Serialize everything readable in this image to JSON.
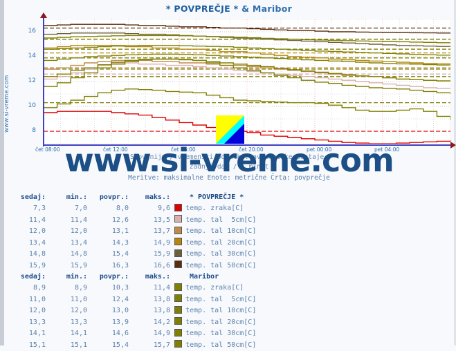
{
  "page": {
    "title": "* POVPREČJE * & Maribor",
    "title_main": "* POVPREČJE *",
    "title_amp": "& Maribor",
    "vertical_watermark": "www.si-vreme.com",
    "big_watermark": "www.si-vreme.com",
    "subtitle_line1": "Slovenija / vremenski podatki: avtomatske postaje.",
    "subtitle_line2": "zadnji dan / 5 minut",
    "subtitle_line3": "Meritve: maksimalne  Enote: metrične  Črta: povprečje"
  },
  "chart_data": {
    "type": "line",
    "title": "* POVPREČJE * & Maribor",
    "xlabel": "",
    "ylabel": "",
    "ylim": [
      7,
      17
    ],
    "yticks": [
      8,
      10,
      12,
      14,
      16
    ],
    "xticks": [
      "čet 08:00",
      "čet 12:00",
      "čet 16:00",
      "čet 20:00",
      "pet 00:00",
      "pet 04:00"
    ],
    "grid": true,
    "legend_position": "below-table",
    "series": [
      {
        "name": "* POVPREČJE * temp. zraka[C]",
        "color": "#e00000",
        "sedaj": 7.3,
        "min": 7.0,
        "povpr": 8.0,
        "maks": 9.6,
        "values": [
          9.5,
          9.6,
          9.6,
          9.6,
          9.6,
          9.5,
          9.4,
          9.3,
          9.1,
          8.9,
          8.7,
          8.5,
          8.3,
          8.2,
          8.0,
          7.9,
          7.7,
          7.6,
          7.5,
          7.4,
          7.3,
          7.2,
          7.1,
          7.05,
          7.0,
          7.0,
          7.05,
          7.1,
          7.15,
          7.2,
          7.3
        ]
      },
      {
        "name": "* POVPREČJE * temp. tal  5cm[C]",
        "color": "#d8b0b0",
        "sedaj": 11.4,
        "min": 11.4,
        "povpr": 12.6,
        "maks": 13.5,
        "values": [
          12.2,
          12.4,
          12.7,
          13.0,
          13.3,
          13.5,
          13.5,
          13.4,
          13.4,
          13.3,
          13.3,
          13.2,
          13.1,
          13.0,
          12.9,
          12.8,
          12.7,
          12.6,
          12.5,
          12.4,
          12.3,
          12.2,
          12.1,
          12.0,
          11.9,
          11.8,
          11.7,
          11.6,
          11.5,
          11.45,
          11.4
        ]
      },
      {
        "name": "* POVPREČJE * temp. tal 10cm[C]",
        "color": "#c08a4a",
        "sedaj": 12.0,
        "min": 12.0,
        "povpr": 13.1,
        "maks": 13.7,
        "values": [
          13.0,
          13.1,
          13.3,
          13.5,
          13.6,
          13.7,
          13.7,
          13.7,
          13.6,
          13.6,
          13.5,
          13.5,
          13.4,
          13.3,
          13.3,
          13.2,
          13.1,
          13.0,
          12.9,
          12.8,
          12.7,
          12.6,
          12.5,
          12.45,
          12.4,
          12.3,
          12.2,
          12.15,
          12.1,
          12.05,
          12.0
        ]
      },
      {
        "name": "* POVPREČJE * temp. tal 20cm[C]",
        "color": "#b8860b",
        "sedaj": 13.4,
        "min": 13.4,
        "povpr": 14.3,
        "maks": 14.9,
        "values": [
          14.7,
          14.8,
          14.9,
          14.9,
          14.9,
          14.9,
          14.8,
          14.8,
          14.7,
          14.7,
          14.6,
          14.6,
          14.5,
          14.4,
          14.4,
          14.3,
          14.2,
          14.1,
          14.0,
          13.95,
          13.9,
          13.8,
          13.75,
          13.7,
          13.65,
          13.6,
          13.55,
          13.5,
          13.45,
          13.42,
          13.4
        ]
      },
      {
        "name": "* POVPREČJE * temp. tal 30cm[C]",
        "color": "#6b6038",
        "sedaj": 14.8,
        "min": 14.8,
        "povpr": 15.4,
        "maks": 15.9,
        "values": [
          15.8,
          15.85,
          15.9,
          15.9,
          15.9,
          15.9,
          15.85,
          15.8,
          15.8,
          15.75,
          15.7,
          15.65,
          15.6,
          15.55,
          15.5,
          15.45,
          15.4,
          15.35,
          15.3,
          15.25,
          15.2,
          15.15,
          15.1,
          15.05,
          15.0,
          14.95,
          14.9,
          14.88,
          14.85,
          14.82,
          14.8
        ]
      },
      {
        "name": "* POVPREČJE * temp. tal 50cm[C]",
        "color": "#5a2d0c",
        "sedaj": 15.9,
        "min": 15.9,
        "povpr": 16.3,
        "maks": 16.6,
        "values": [
          16.5,
          16.55,
          16.6,
          16.6,
          16.6,
          16.6,
          16.55,
          16.5,
          16.5,
          16.45,
          16.4,
          16.4,
          16.35,
          16.3,
          16.3,
          16.25,
          16.2,
          16.15,
          16.1,
          16.1,
          16.05,
          16.0,
          16.0,
          15.98,
          15.96,
          15.94,
          15.93,
          15.92,
          15.91,
          15.9,
          15.9
        ]
      },
      {
        "name": "Maribor temp. zraka[C]",
        "color": "#808000",
        "sedaj": 8.9,
        "min": 8.9,
        "povpr": 10.3,
        "maks": 11.4,
        "values": [
          9.9,
          10.2,
          10.5,
          10.8,
          11.1,
          11.3,
          11.4,
          11.35,
          11.3,
          11.2,
          11.15,
          11.1,
          10.9,
          10.7,
          10.5,
          10.45,
          10.4,
          10.35,
          10.3,
          10.3,
          10.25,
          10.1,
          9.9,
          9.7,
          9.6,
          9.6,
          9.7,
          9.8,
          9.6,
          9.2,
          8.9
        ]
      },
      {
        "name": "Maribor temp. tal  5cm[C]",
        "color": "#808000",
        "sedaj": 11.0,
        "min": 11.0,
        "povpr": 12.4,
        "maks": 13.8,
        "values": [
          11.6,
          11.9,
          12.3,
          12.7,
          13.1,
          13.4,
          13.6,
          13.75,
          13.8,
          13.8,
          13.75,
          13.7,
          13.5,
          13.3,
          13.1,
          12.9,
          12.7,
          12.5,
          12.3,
          12.1,
          11.95,
          11.85,
          11.7,
          11.6,
          11.5,
          11.45,
          11.4,
          11.3,
          11.2,
          11.1,
          11.0
        ]
      },
      {
        "name": "Maribor temp. tal 10cm[C]",
        "color": "#808000",
        "sedaj": 12.0,
        "min": 12.0,
        "povpr": 13.0,
        "maks": 13.8,
        "values": [
          12.4,
          12.6,
          12.9,
          13.1,
          13.35,
          13.55,
          13.7,
          13.78,
          13.8,
          13.8,
          13.78,
          13.7,
          13.6,
          13.5,
          13.4,
          13.3,
          13.2,
          13.05,
          12.95,
          12.85,
          12.75,
          12.65,
          12.55,
          12.45,
          12.4,
          12.3,
          12.2,
          12.15,
          12.1,
          12.05,
          12.0
        ]
      },
      {
        "name": "Maribor temp. tal 20cm[C]",
        "color": "#808000",
        "sedaj": 13.3,
        "min": 13.3,
        "povpr": 13.9,
        "maks": 14.2,
        "values": [
          13.7,
          13.8,
          13.9,
          14.0,
          14.05,
          14.1,
          14.15,
          14.18,
          14.2,
          14.2,
          14.18,
          14.15,
          14.1,
          14.05,
          14.0,
          13.95,
          13.9,
          13.85,
          13.8,
          13.75,
          13.7,
          13.65,
          13.6,
          13.55,
          13.5,
          13.45,
          13.42,
          13.4,
          13.36,
          13.33,
          13.3
        ]
      },
      {
        "name": "Maribor temp. tal 30cm[C]",
        "color": "#808000",
        "sedaj": 14.1,
        "min": 14.1,
        "povpr": 14.6,
        "maks": 14.9,
        "values": [
          14.6,
          14.65,
          14.7,
          14.75,
          14.8,
          14.85,
          14.88,
          14.9,
          14.9,
          14.9,
          14.88,
          14.85,
          14.82,
          14.8,
          14.75,
          14.7,
          14.65,
          14.6,
          14.55,
          14.5,
          14.45,
          14.42,
          14.38,
          14.34,
          14.3,
          14.26,
          14.22,
          14.18,
          14.15,
          14.12,
          14.1
        ]
      },
      {
        "name": "Maribor temp. tal 50cm[C]",
        "color": "#808000",
        "sedaj": 15.1,
        "min": 15.1,
        "povpr": 15.4,
        "maks": 15.7,
        "values": [
          15.5,
          15.55,
          15.6,
          15.62,
          15.65,
          15.68,
          15.7,
          15.7,
          15.7,
          15.7,
          15.68,
          15.65,
          15.62,
          15.6,
          15.56,
          15.52,
          15.48,
          15.44,
          15.4,
          15.37,
          15.34,
          15.31,
          15.29,
          15.26,
          15.24,
          15.22,
          15.2,
          15.17,
          15.15,
          15.12,
          15.1
        ]
      }
    ]
  },
  "table1": {
    "headers": [
      "sedaj:",
      "min.:",
      "povpr.:",
      "maks.:"
    ],
    "group_label": "* POVPREČJE *",
    "rows": [
      {
        "sedaj": "7,3",
        "min": "7,0",
        "povpr": "8,0",
        "maks": "9,6",
        "color": "#e00000",
        "label": "temp. zraka[C]"
      },
      {
        "sedaj": "11,4",
        "min": "11,4",
        "povpr": "12,6",
        "maks": "13,5",
        "color": "#d8b0b0",
        "label": "temp. tal  5cm[C]"
      },
      {
        "sedaj": "12,0",
        "min": "12,0",
        "povpr": "13,1",
        "maks": "13,7",
        "color": "#c08a4a",
        "label": "temp. tal 10cm[C]"
      },
      {
        "sedaj": "13,4",
        "min": "13,4",
        "povpr": "14,3",
        "maks": "14,9",
        "color": "#b8860b",
        "label": "temp. tal 20cm[C]"
      },
      {
        "sedaj": "14,8",
        "min": "14,8",
        "povpr": "15,4",
        "maks": "15,9",
        "color": "#6b6038",
        "label": "temp. tal 30cm[C]"
      },
      {
        "sedaj": "15,9",
        "min": "15,9",
        "povpr": "16,3",
        "maks": "16,6",
        "color": "#5a2d0c",
        "label": "temp. tal 50cm[C]"
      }
    ]
  },
  "table2": {
    "headers": [
      "sedaj:",
      "min.:",
      "povpr.:",
      "maks.:"
    ],
    "group_label": "Maribor",
    "rows": [
      {
        "sedaj": "8,9",
        "min": "8,9",
        "povpr": "10,3",
        "maks": "11,4",
        "color": "#808000",
        "label": "temp. zraka[C]"
      },
      {
        "sedaj": "11,0",
        "min": "11,0",
        "povpr": "12,4",
        "maks": "13,8",
        "color": "#808000",
        "label": "temp. tal  5cm[C]"
      },
      {
        "sedaj": "12,0",
        "min": "12,0",
        "povpr": "13,0",
        "maks": "13,8",
        "color": "#808000",
        "label": "temp. tal 10cm[C]"
      },
      {
        "sedaj": "13,3",
        "min": "13,3",
        "povpr": "13,9",
        "maks": "14,2",
        "color": "#808000",
        "label": "temp. tal 20cm[C]"
      },
      {
        "sedaj": "14,1",
        "min": "14,1",
        "povpr": "14,6",
        "maks": "14,9",
        "color": "#808000",
        "label": "temp. tal 30cm[C]"
      },
      {
        "sedaj": "15,1",
        "min": "15,1",
        "povpr": "15,4",
        "maks": "15,7",
        "color": "#808000",
        "label": "temp. tal 50cm[C]"
      }
    ]
  },
  "colors": {
    "title": "#1f5fa0",
    "axis": "#4040c0",
    "watermark": "#1b4f86",
    "text": "#5d82aa",
    "plot_bg": "#ffffff",
    "page_bg": "#f7f9fd"
  }
}
